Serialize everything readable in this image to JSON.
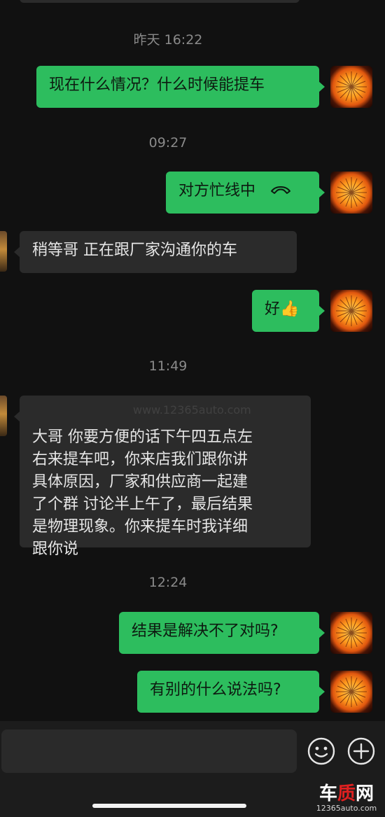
{
  "messages": {
    "ts1": "昨天 16:22",
    "m1": "现在什么情况？什么时候能提车",
    "ts2": "09:27",
    "m2": "对方忙线中",
    "m3": "稍等哥  正在跟厂家沟通你的车",
    "m4": "好",
    "m4_emoji": "👍",
    "ts3": "11:49",
    "m5": "大哥 你要方便的话下午四五点左\n右来提车吧，你来店我们跟你讲\n具体原因，厂家和供应商一起建\n了个群  讨论半上午了，最后结果\n是物理现象。你来提车时我详细\n跟你说",
    "ts4": "12:24",
    "m6": "结果是解决不了对吗?",
    "m7": "有别的什么说法吗?"
  },
  "icons": {
    "call": "phone-hangup-icon",
    "emoji": "smiley-icon",
    "plus": "plus-circle-icon"
  },
  "watermark": {
    "logo_a": "车",
    "logo_b": "质",
    "logo_c": "网",
    "url": "12365auto.com",
    "ghost": "www.12365auto.com"
  },
  "colors": {
    "my_bubble": "#2dbd5e",
    "other_bubble": "#2b2b2b",
    "background": "#111111"
  }
}
